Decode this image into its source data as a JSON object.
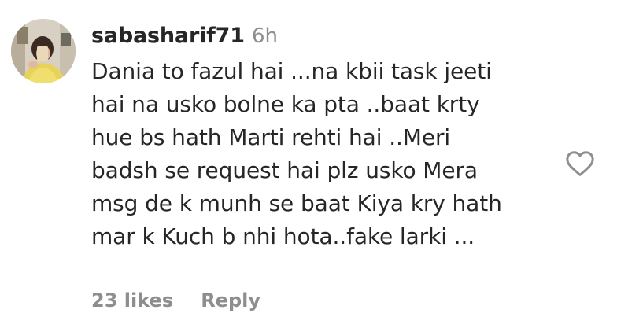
{
  "comment": {
    "username": "sabasharif71",
    "timestamp": "6h",
    "text_lines": [
      "Dania to fazul hai ...na kbii task jeeti",
      "hai na usko bolne ka pta ..baat krty",
      "hue bs hath Marti rehti hai ..Meri",
      "badsh se request hai plz usko Mera",
      "msg de k munh se baat Kiya kry hath",
      "mar k Kuch b nhi hota..fake larki ..."
    ],
    "likes_label": "23 likes",
    "reply_label": "Reply",
    "like_icon": "heart-outline-icon"
  }
}
